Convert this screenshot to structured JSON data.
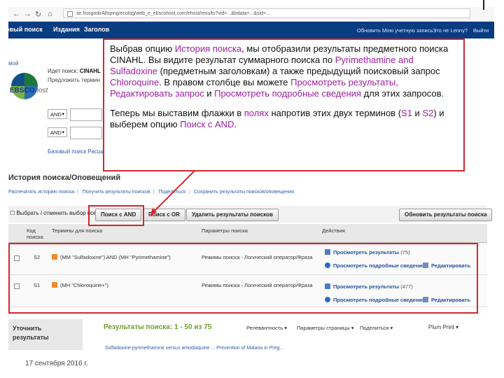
{
  "browser": {
    "url_text": "se.hosgodirAllsping/ecolog/web_e_ebscohost.com/ehost/results?vid=...&bdata=...&sid=...",
    "nav_icons": [
      "back-icon",
      "forward-icon",
      "reload-icon",
      "home-icon"
    ]
  },
  "topnav": {
    "items": [
      "овый поиск",
      "Издания",
      "Заголов"
    ],
    "account_link": "Обновить Мою учетную запись",
    "lenny": "Это не Lenny?",
    "exit": "Выйти"
  },
  "header": {
    "my_label": "мой",
    "logo_text": "EBSCO",
    "logo_suffix": "host",
    "searching_prefix": "Идет поиск:",
    "searching_db": "CINAHL",
    "suggest": "Предложить термин",
    "bool_values": [
      "AND",
      "AND"
    ],
    "basic_links": "Базовый поиск  Расширенный поиск  Выбор поиск"
  },
  "history": {
    "title": "История поиска/Оповещений",
    "links": [
      "Распечатать историю поиска",
      "Получить результаты поисков",
      "Поделиться",
      "Сохранить результаты поисков/оповещения"
    ],
    "select_toggle": "Выбрать / отменить выбор всех",
    "btn_and": "Поиск с AND",
    "btn_or": "Поиск с OR",
    "btn_delete": "Удалить результаты поисков",
    "btn_refresh": "Обновить результаты поиска",
    "columns": {
      "id": "Код поиска",
      "terms": "Термины для поиска",
      "options": "Параметры поиска",
      "actions": "Действия"
    },
    "rows": [
      {
        "id": "S2",
        "terms": "(MM \"Sulfadoxine\") AND (MH \"Pyrimethamine\")",
        "options": "Режимы поиска - Логический оператор/Фраза",
        "view": "Просмотреть результаты",
        "count": "(75)",
        "details": "Просмотреть подробные сведения",
        "edit": "Редактировать"
      },
      {
        "id": "S1",
        "terms": "(MH \"Chloroquine+\")",
        "options": "Режимы поиска - Логический оператор/Фраза",
        "view": "Просмотреть результаты",
        "count": "(477)",
        "details": "Просмотреть подробные сведения",
        "edit": "Редактировать"
      }
    ]
  },
  "results": {
    "refine_line1": "Уточнить",
    "refine_line2": "результаты",
    "title": "Результаты поиска: 1 - 50 из 75",
    "relevance": "Релевантность",
    "page_options": "Параметры страницы",
    "share": "Поделиться",
    "plum": "Plum Print",
    "cut_line": "Sulfadoxine-pyrimethamine versus amodiaquine ... Prevention of Malaria in Preg..."
  },
  "footer": {
    "date": "17 сентября 2016 г."
  },
  "callout": {
    "p1": [
      {
        "t": "Выбрав опцию ",
        "hl": false
      },
      {
        "t": "История поиска",
        "hl": true
      },
      {
        "t": ", мы отобразили результаты предметного поиска CINAHL.  Вы видите результат суммарного поиска по ",
        "hl": false
      },
      {
        "t": "Pyrimethamine and Sulfadoxine",
        "hl": true
      },
      {
        "t": " (предметным заголовкам) а также предыдущий поисковый запрос ",
        "hl": false
      },
      {
        "t": "Chloroquine",
        "hl": true
      },
      {
        "t": ". В правом столбце вы можете ",
        "hl": false
      },
      {
        "t": "Просмотреть результаты, Редактировать запрос",
        "hl": true
      },
      {
        "t": " и ",
        "hl": false
      },
      {
        "t": "Просмотреть подробные сведения",
        "hl": true
      },
      {
        "t": " для этих запросов.",
        "hl": false
      }
    ],
    "p2": [
      {
        "t": "Теперь мы выставим флажки в ",
        "hl": false
      },
      {
        "t": "полях",
        "hl": true
      },
      {
        "t": " напротив этих двух терминов (",
        "hl": false
      },
      {
        "t": "S1",
        "hl": true
      },
      {
        "t": " и ",
        "hl": false
      },
      {
        "t": "S2",
        "hl": true
      },
      {
        "t": ") и выберем опцию ",
        "hl": false
      },
      {
        "t": "Поиск с AND",
        "hl": true
      },
      {
        "t": ".",
        "hl": false
      }
    ]
  },
  "colors": {
    "nav": "#0a3c82",
    "highlight": "#9d1ea0",
    "frame": "#d6262e"
  }
}
